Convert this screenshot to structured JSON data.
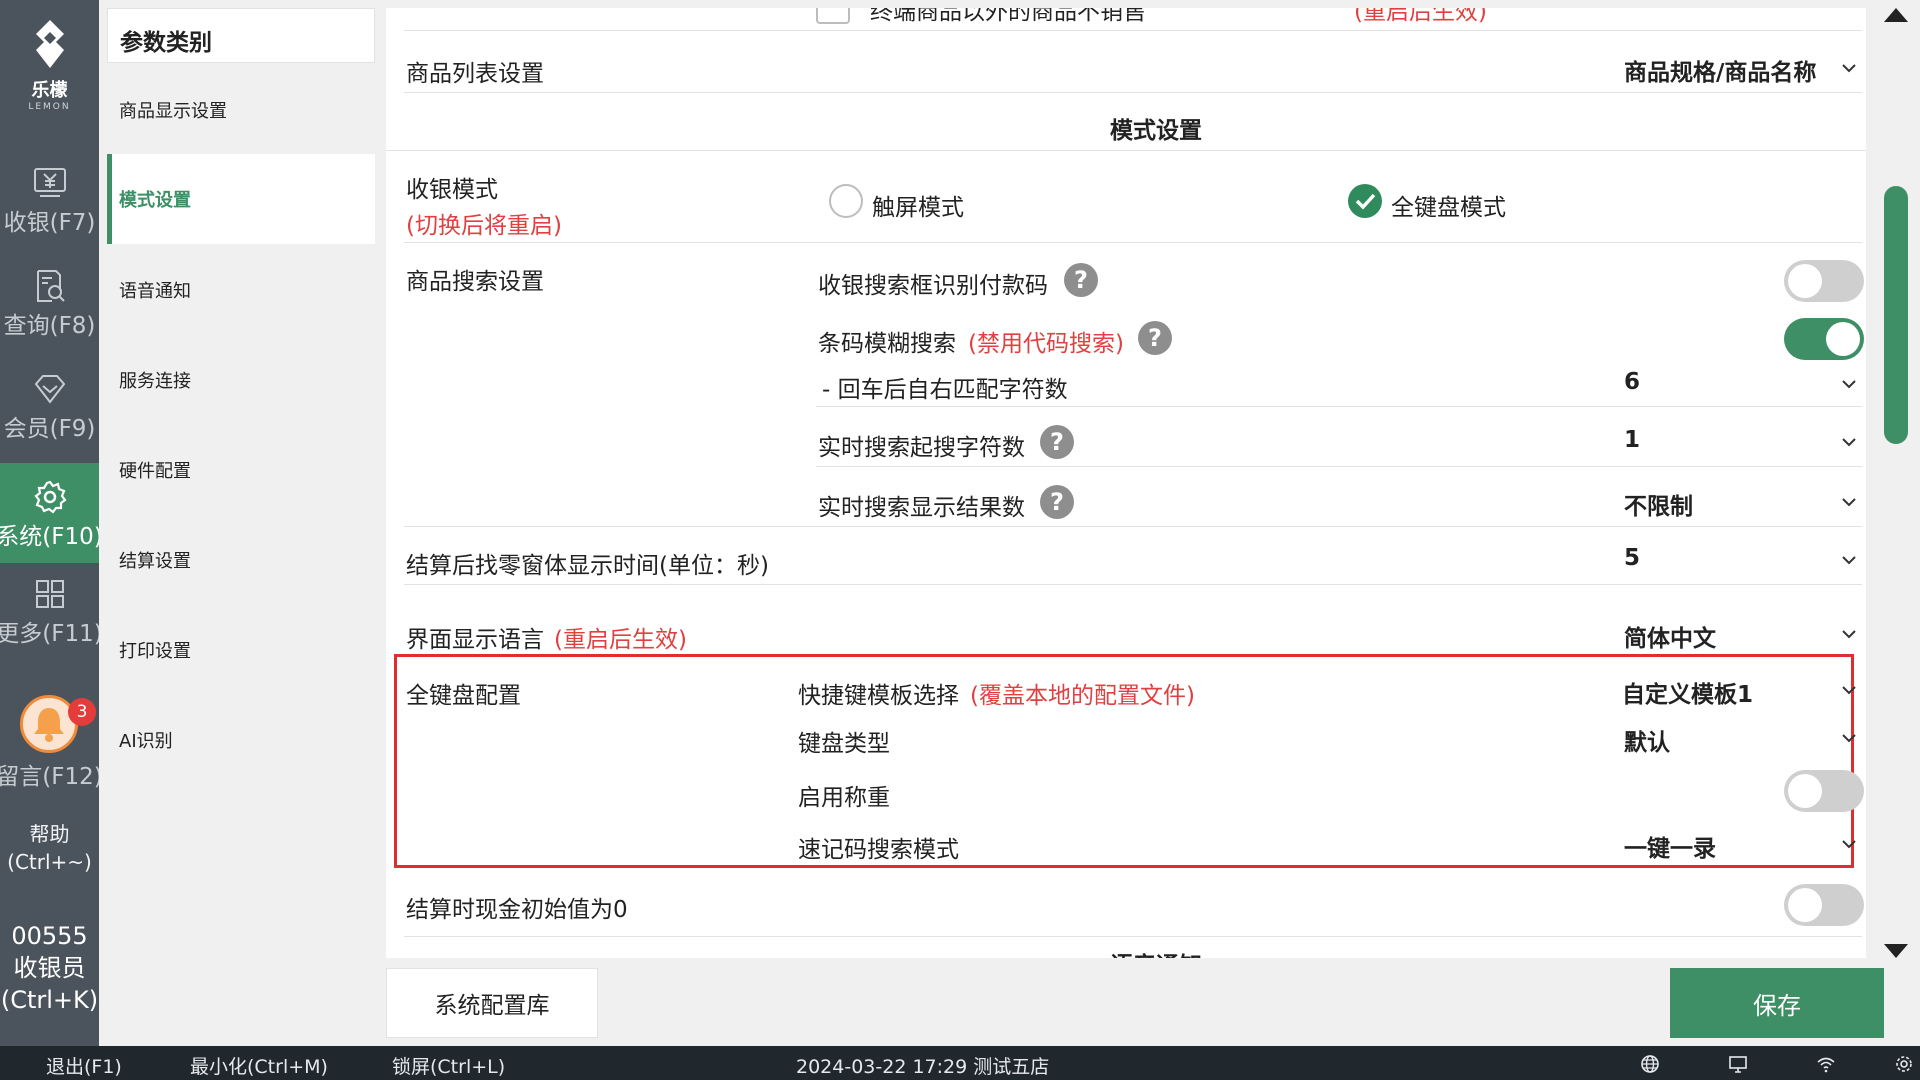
{
  "nav": {
    "logo_cn": "乐檬",
    "logo_en": "LEMON",
    "items": [
      {
        "label": "收银(F7)",
        "icon": "cashier-icon"
      },
      {
        "label": "查询(F8)",
        "icon": "query-icon"
      },
      {
        "label": "会员(F9)",
        "icon": "member-icon"
      },
      {
        "label": "系统(F10)",
        "icon": "gear-icon"
      },
      {
        "label": "更多(F11)",
        "icon": "grid-icon"
      },
      {
        "label": "留言(F12)",
        "icon": "bell-icon"
      }
    ],
    "message_badge": "3",
    "help_line1": "帮助",
    "help_line2": "(Ctrl+~)",
    "user_id": "00555",
    "user_role": "收银员",
    "user_shortcut": "(Ctrl+K)"
  },
  "categories": {
    "title": "参数类别",
    "items": [
      "商品显示设置",
      "模式设置",
      "语音通知",
      "服务连接",
      "硬件配置",
      "结算设置",
      "打印设置",
      "AI识别"
    ],
    "active_index": 1
  },
  "settings": {
    "top_partial": "终端商品以外的商品不销售",
    "top_partial_note": "(重启后生效)",
    "goods_list_label": "商品列表设置",
    "goods_list_value": "商品规格/商品名称",
    "section_mode": "模式设置",
    "cash_mode_label": "收银模式",
    "cash_mode_note": "(切换后将重启)",
    "mode_touch": "触屏模式",
    "mode_keyboard": "全键盘模式",
    "search_label": "商品搜索设置",
    "search_paycode": "收银搜索框识别付款码",
    "search_paycode_on": false,
    "barcode_fuzzy": "条码模糊搜索",
    "barcode_fuzzy_note": "(禁用代码搜索)",
    "barcode_fuzzy_on": true,
    "right_match": "- 回车后自右匹配字符数",
    "right_match_value": "6",
    "realtime_start": "实时搜索起搜字符数",
    "realtime_start_value": "1",
    "realtime_results": "实时搜索显示结果数",
    "realtime_results_value": "不限制",
    "change_window": "结算后找零窗体显示时间(单位：秒)",
    "change_window_value": "5",
    "ui_language": "界面显示语言",
    "ui_language_note": "(重启后生效)",
    "ui_language_value": "简体中文",
    "kb_config": "全键盘配置",
    "hotkey_template": "快捷键模板选择",
    "hotkey_template_note": "(覆盖本地的配置文件)",
    "hotkey_template_value": "自定义模板1",
    "kb_type": "键盘类型",
    "kb_type_value": "默认",
    "weighing": "启用称重",
    "weighing_on": false,
    "quick_code": "速记码搜索模式",
    "quick_code_value": "一键一录",
    "cash_init_zero": "结算时现金初始值为0",
    "cash_init_zero_on": false,
    "section_voice": "语音通知"
  },
  "buttons": {
    "config_library": "系统配置库",
    "save": "保存"
  },
  "status": {
    "exit": "退出(F1)",
    "minimize": "最小化(Ctrl+M)",
    "lock": "锁屏(Ctrl+L)",
    "datetime_store": "2024-03-22 17:29  测试五店"
  },
  "colors": {
    "accent": "#3e8f66",
    "nav_bg": "#4b545c",
    "highlight": "#e12d2d",
    "note_red": "#e14040"
  }
}
